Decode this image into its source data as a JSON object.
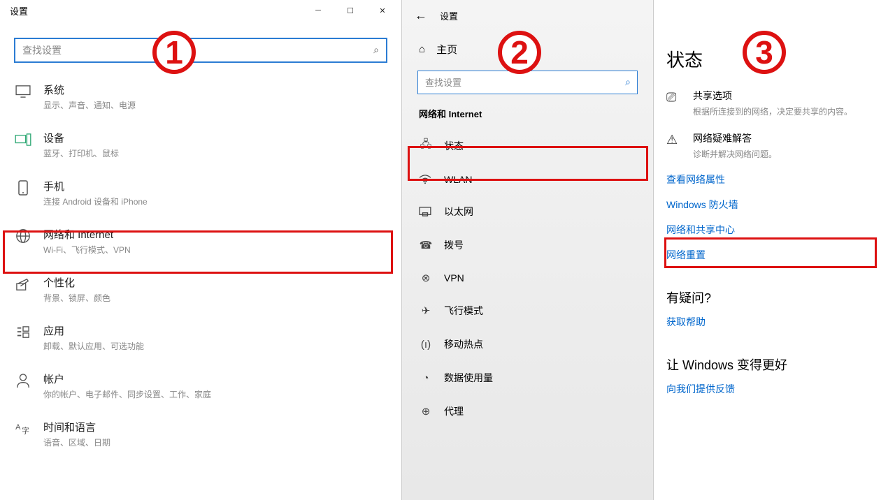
{
  "pane1": {
    "title": "设置",
    "search_placeholder": "查找设置",
    "categories": [
      {
        "title": "系统",
        "sub": "显示、声音、通知、电源"
      },
      {
        "title": "设备",
        "sub": "蓝牙、打印机、鼠标"
      },
      {
        "title": "手机",
        "sub": "连接 Android 设备和 iPhone"
      },
      {
        "title": "网络和 Internet",
        "sub": "Wi-Fi、飞行模式、VPN"
      },
      {
        "title": "个性化",
        "sub": "背景、锁屏、颜色"
      },
      {
        "title": "应用",
        "sub": "卸载、默认应用、可选功能"
      },
      {
        "title": "帐户",
        "sub": "你的帐户、电子邮件、同步设置、工作、家庭"
      },
      {
        "title": "时间和语言",
        "sub": "语音、区域、日期"
      }
    ]
  },
  "pane2": {
    "back": "设置",
    "home": "主页",
    "search_placeholder": "查找设置",
    "section": "网络和 Internet",
    "items": [
      "状态",
      "WLAN",
      "以太网",
      "拨号",
      "VPN",
      "飞行模式",
      "移动热点",
      "数据使用量",
      "代理"
    ]
  },
  "pane3": {
    "title": "状态",
    "share_title": "共享选项",
    "share_sub": "根据所连接到的网络，决定要共享的内容。",
    "trouble_title": "网络疑难解答",
    "trouble_sub": "诊断并解决网络问题。",
    "links": [
      "查看网络属性",
      "Windows 防火墙",
      "网络和共享中心",
      "网络重置"
    ],
    "q_title": "有疑问?",
    "q_link": "获取帮助",
    "better_title": "让 Windows 变得更好",
    "better_link": "向我们提供反馈"
  },
  "badges": {
    "b1": "1",
    "b2": "2",
    "b3": "3"
  }
}
